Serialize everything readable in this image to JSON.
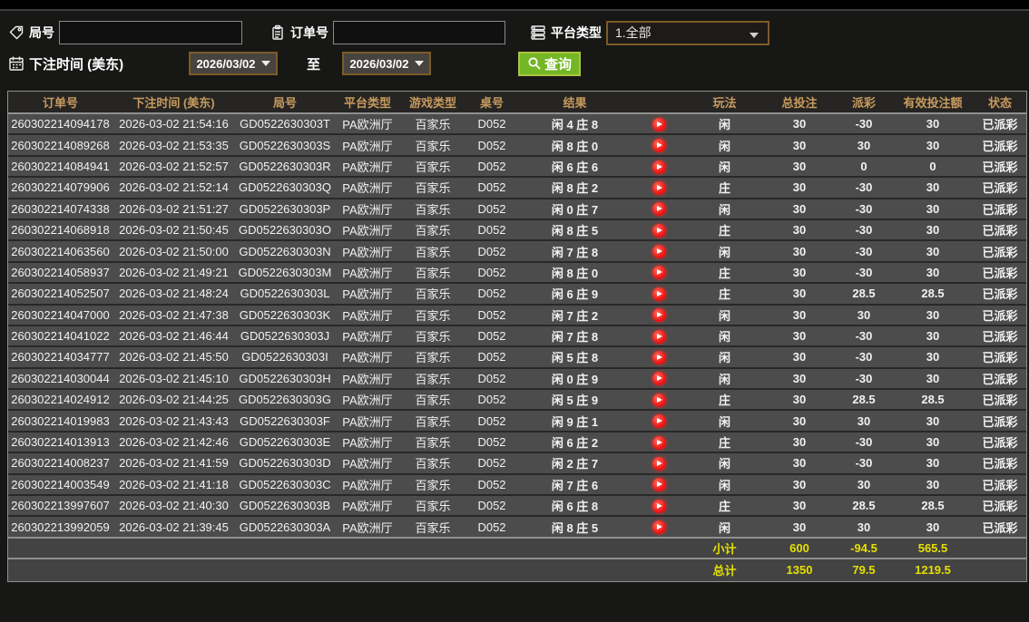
{
  "colors": {
    "header_gold": "#c79b5e",
    "win_red": "#a81f3c",
    "loss_green": "#99d400",
    "status_green": "#35cc35",
    "total_yellow": "#e4e000",
    "query_green": "#74b626",
    "accent_brown": "#7d5b28"
  },
  "filters": {
    "round_label": "局号",
    "round_value": "",
    "order_label": "订单号",
    "order_value": "",
    "platform_label": "平台类型",
    "platform_value": "1.全部",
    "bet_time_label": "下注时间 (美东)",
    "date_from": "2026/03/02",
    "to_label": "至",
    "date_to": "2026/03/02",
    "query_label": "查询"
  },
  "table": {
    "columns": [
      "订单号",
      "下注时间 (美东)",
      "局号",
      "平台类型",
      "游戏类型",
      "桌号",
      "结果",
      "",
      "玩法",
      "总投注",
      "派彩",
      "有效投注额",
      "状态"
    ],
    "rows": [
      {
        "order": "260302214094178",
        "time": "2026-03-02 21:54:16",
        "round": "GD0522630303T",
        "platform": "PA欧洲厅",
        "game": "百家乐",
        "table_no": "D052",
        "result": "闲 4 庄 8",
        "play": "闲",
        "total": "30",
        "payout": "-30",
        "valid": "30",
        "status": "已派彩"
      },
      {
        "order": "260302214089268",
        "time": "2026-03-02 21:53:35",
        "round": "GD0522630303S",
        "platform": "PA欧洲厅",
        "game": "百家乐",
        "table_no": "D052",
        "result": "闲 8 庄 0",
        "play": "闲",
        "total": "30",
        "payout": "30",
        "valid": "30",
        "status": "已派彩"
      },
      {
        "order": "260302214084941",
        "time": "2026-03-02 21:52:57",
        "round": "GD0522630303R",
        "platform": "PA欧洲厅",
        "game": "百家乐",
        "table_no": "D052",
        "result": "闲 6 庄 6",
        "play": "闲",
        "total": "30",
        "payout": "0",
        "valid": "0",
        "status": "已派彩"
      },
      {
        "order": "260302214079906",
        "time": "2026-03-02 21:52:14",
        "round": "GD0522630303Q",
        "platform": "PA欧洲厅",
        "game": "百家乐",
        "table_no": "D052",
        "result": "闲 8 庄 2",
        "play": "庄",
        "total": "30",
        "payout": "-30",
        "valid": "30",
        "status": "已派彩"
      },
      {
        "order": "260302214074338",
        "time": "2026-03-02 21:51:27",
        "round": "GD0522630303P",
        "platform": "PA欧洲厅",
        "game": "百家乐",
        "table_no": "D052",
        "result": "闲 0 庄 7",
        "play": "闲",
        "total": "30",
        "payout": "-30",
        "valid": "30",
        "status": "已派彩"
      },
      {
        "order": "260302214068918",
        "time": "2026-03-02 21:50:45",
        "round": "GD0522630303O",
        "platform": "PA欧洲厅",
        "game": "百家乐",
        "table_no": "D052",
        "result": "闲 8 庄 5",
        "play": "庄",
        "total": "30",
        "payout": "-30",
        "valid": "30",
        "status": "已派彩"
      },
      {
        "order": "260302214063560",
        "time": "2026-03-02 21:50:00",
        "round": "GD0522630303N",
        "platform": "PA欧洲厅",
        "game": "百家乐",
        "table_no": "D052",
        "result": "闲 7 庄 8",
        "play": "闲",
        "total": "30",
        "payout": "-30",
        "valid": "30",
        "status": "已派彩"
      },
      {
        "order": "260302214058937",
        "time": "2026-03-02 21:49:21",
        "round": "GD0522630303M",
        "platform": "PA欧洲厅",
        "game": "百家乐",
        "table_no": "D052",
        "result": "闲 8 庄 0",
        "play": "庄",
        "total": "30",
        "payout": "-30",
        "valid": "30",
        "status": "已派彩"
      },
      {
        "order": "260302214052507",
        "time": "2026-03-02 21:48:24",
        "round": "GD0522630303L",
        "platform": "PA欧洲厅",
        "game": "百家乐",
        "table_no": "D052",
        "result": "闲 6 庄 9",
        "play": "庄",
        "total": "30",
        "payout": "28.5",
        "valid": "28.5",
        "status": "已派彩"
      },
      {
        "order": "260302214047000",
        "time": "2026-03-02 21:47:38",
        "round": "GD0522630303K",
        "platform": "PA欧洲厅",
        "game": "百家乐",
        "table_no": "D052",
        "result": "闲 7 庄 2",
        "play": "闲",
        "total": "30",
        "payout": "30",
        "valid": "30",
        "status": "已派彩"
      },
      {
        "order": "260302214041022",
        "time": "2026-03-02 21:46:44",
        "round": "GD0522630303J",
        "platform": "PA欧洲厅",
        "game": "百家乐",
        "table_no": "D052",
        "result": "闲 7 庄 8",
        "play": "闲",
        "total": "30",
        "payout": "-30",
        "valid": "30",
        "status": "已派彩"
      },
      {
        "order": "260302214034777",
        "time": "2026-03-02 21:45:50",
        "round": "GD0522630303I",
        "platform": "PA欧洲厅",
        "game": "百家乐",
        "table_no": "D052",
        "result": "闲 5 庄 8",
        "play": "闲",
        "total": "30",
        "payout": "-30",
        "valid": "30",
        "status": "已派彩"
      },
      {
        "order": "260302214030044",
        "time": "2026-03-02 21:45:10",
        "round": "GD0522630303H",
        "platform": "PA欧洲厅",
        "game": "百家乐",
        "table_no": "D052",
        "result": "闲 0 庄 9",
        "play": "闲",
        "total": "30",
        "payout": "-30",
        "valid": "30",
        "status": "已派彩"
      },
      {
        "order": "260302214024912",
        "time": "2026-03-02 21:44:25",
        "round": "GD0522630303G",
        "platform": "PA欧洲厅",
        "game": "百家乐",
        "table_no": "D052",
        "result": "闲 5 庄 9",
        "play": "庄",
        "total": "30",
        "payout": "28.5",
        "valid": "28.5",
        "status": "已派彩"
      },
      {
        "order": "260302214019983",
        "time": "2026-03-02 21:43:43",
        "round": "GD0522630303F",
        "platform": "PA欧洲厅",
        "game": "百家乐",
        "table_no": "D052",
        "result": "闲 9 庄 1",
        "play": "闲",
        "total": "30",
        "payout": "30",
        "valid": "30",
        "status": "已派彩"
      },
      {
        "order": "260302214013913",
        "time": "2026-03-02 21:42:46",
        "round": "GD0522630303E",
        "platform": "PA欧洲厅",
        "game": "百家乐",
        "table_no": "D052",
        "result": "闲 6 庄 2",
        "play": "庄",
        "total": "30",
        "payout": "-30",
        "valid": "30",
        "status": "已派彩"
      },
      {
        "order": "260302214008237",
        "time": "2026-03-02 21:41:59",
        "round": "GD0522630303D",
        "platform": "PA欧洲厅",
        "game": "百家乐",
        "table_no": "D052",
        "result": "闲 2 庄 7",
        "play": "闲",
        "total": "30",
        "payout": "-30",
        "valid": "30",
        "status": "已派彩"
      },
      {
        "order": "260302214003549",
        "time": "2026-03-02 21:41:18",
        "round": "GD0522630303C",
        "platform": "PA欧洲厅",
        "game": "百家乐",
        "table_no": "D052",
        "result": "闲 7 庄 6",
        "play": "闲",
        "total": "30",
        "payout": "30",
        "valid": "30",
        "status": "已派彩"
      },
      {
        "order": "260302213997607",
        "time": "2026-03-02 21:40:30",
        "round": "GD0522630303B",
        "platform": "PA欧洲厅",
        "game": "百家乐",
        "table_no": "D052",
        "result": "闲 6 庄 8",
        "play": "庄",
        "total": "30",
        "payout": "28.5",
        "valid": "28.5",
        "status": "已派彩"
      },
      {
        "order": "260302213992059",
        "time": "2026-03-02 21:39:45",
        "round": "GD0522630303A",
        "platform": "PA欧洲厅",
        "game": "百家乐",
        "table_no": "D052",
        "result": "闲 8 庄 5",
        "play": "闲",
        "total": "30",
        "payout": "30",
        "valid": "30",
        "status": "已派彩"
      }
    ],
    "subtotal": {
      "label": "小计",
      "total": "600",
      "payout": "-94.5",
      "valid": "565.5"
    },
    "grand_total": {
      "label": "总计",
      "total": "1350",
      "payout": "79.5",
      "valid": "1219.5"
    }
  }
}
